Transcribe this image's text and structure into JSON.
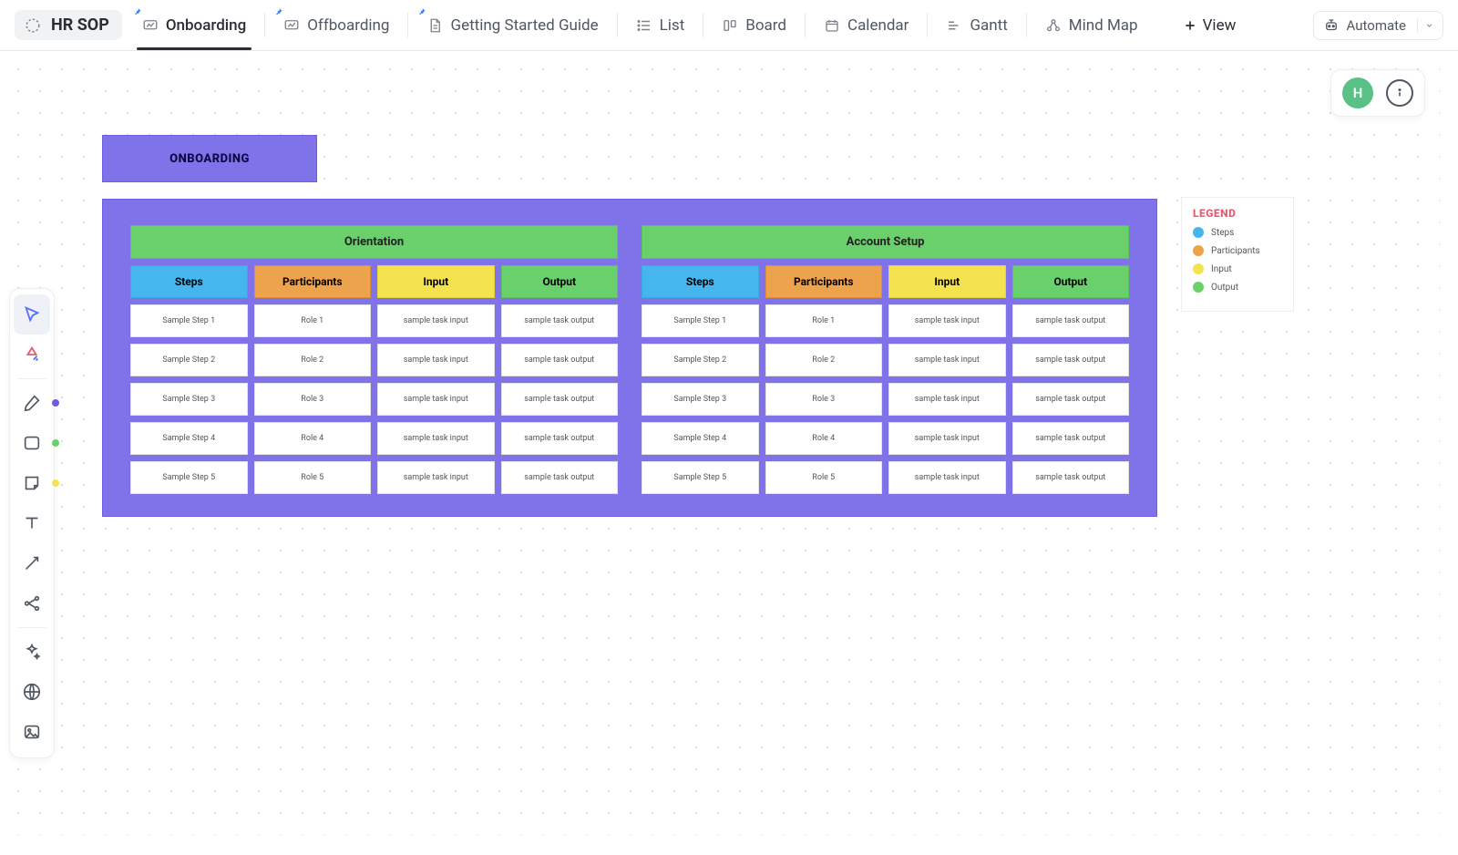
{
  "app_title": "HR SOP",
  "tabs": [
    {
      "label": "Onboarding",
      "icon": "whiteboard",
      "pinned": true,
      "active": true
    },
    {
      "label": "Offboarding",
      "icon": "whiteboard",
      "pinned": true,
      "active": false
    },
    {
      "label": "Getting Started Guide",
      "icon": "doc",
      "pinned": true,
      "active": false
    },
    {
      "label": "List",
      "icon": "list",
      "pinned": false,
      "active": false
    },
    {
      "label": "Board",
      "icon": "board",
      "pinned": false,
      "active": false
    },
    {
      "label": "Calendar",
      "icon": "calendar",
      "pinned": false,
      "active": false
    },
    {
      "label": "Gantt",
      "icon": "gantt",
      "pinned": false,
      "active": false
    },
    {
      "label": "Mind Map",
      "icon": "mindmap",
      "pinned": false,
      "active": false
    }
  ],
  "view_add_label": "View",
  "automate_label": "Automate",
  "avatar_initial": "H",
  "board_title": "ONBOARDING",
  "column_headers": {
    "steps": "Steps",
    "participants": "Participants",
    "input": "Input",
    "output": "Output"
  },
  "groups": [
    {
      "title": "Orientation",
      "rows": [
        {
          "step": "Sample Step 1",
          "role": "Role 1",
          "input": "sample task input",
          "output": "sample task output"
        },
        {
          "step": "Sample Step 2",
          "role": "Role 2",
          "input": "sample task input",
          "output": "sample task output"
        },
        {
          "step": "Sample Step 3",
          "role": "Role 3",
          "input": "sample task input",
          "output": "sample task output"
        },
        {
          "step": "Sample Step 4",
          "role": "Role 4",
          "input": "sample task input",
          "output": "sample task output"
        },
        {
          "step": "Sample Step 5",
          "role": "Role 5",
          "input": "sample task input",
          "output": "sample task output"
        }
      ]
    },
    {
      "title": "Account Setup",
      "rows": [
        {
          "step": "Sample Step 1",
          "role": "Role 1",
          "input": "sample task input",
          "output": "sample task output"
        },
        {
          "step": "Sample Step 2",
          "role": "Role 2",
          "input": "sample task input",
          "output": "sample task output"
        },
        {
          "step": "Sample Step 3",
          "role": "Role 3",
          "input": "sample task input",
          "output": "sample task output"
        },
        {
          "step": "Sample Step 4",
          "role": "Role 4",
          "input": "sample task input",
          "output": "sample task output"
        },
        {
          "step": "Sample Step 5",
          "role": "Role 5",
          "input": "sample task input",
          "output": "sample task output"
        }
      ]
    }
  ],
  "legend": {
    "title": "LEGEND",
    "items": [
      {
        "label": "Steps",
        "color": "#46b7ee"
      },
      {
        "label": "Participants",
        "color": "#eda24c"
      },
      {
        "label": "Input",
        "color": "#f4e24e"
      },
      {
        "label": "Output",
        "color": "#6ad06b"
      }
    ]
  },
  "toolbox_side_dots": [
    {
      "index": 3,
      "color": "#6c5ce7"
    },
    {
      "index": 4,
      "color": "#6ad06b"
    },
    {
      "index": 5,
      "color": "#f4e24e"
    }
  ]
}
